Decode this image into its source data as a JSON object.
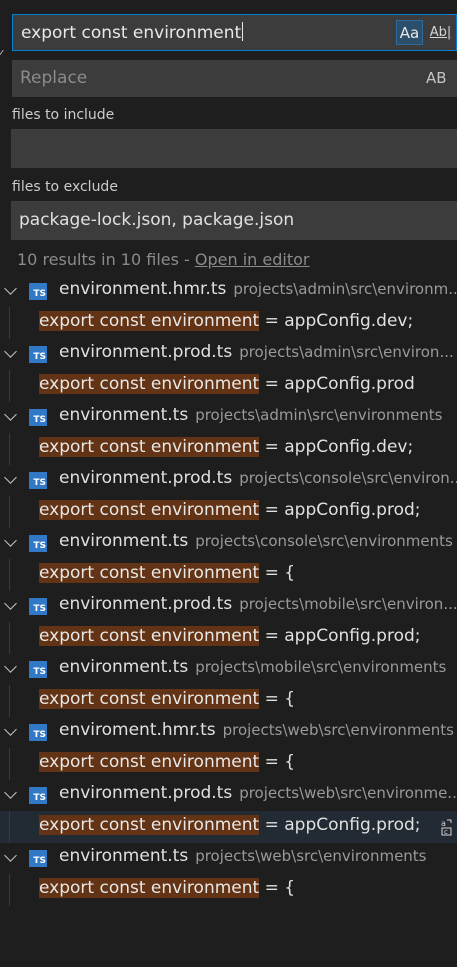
{
  "search": {
    "value": "export const environment",
    "match_case_label": "Aa",
    "whole_word_label": "Ab|"
  },
  "replace": {
    "placeholder": "Replace",
    "preserve_case_label": "AB"
  },
  "files_to_include": {
    "label": "files to include",
    "value": ""
  },
  "files_to_exclude": {
    "label": "files to exclude",
    "value": "package-lock.json, package.json"
  },
  "summary": {
    "text": "10 results in 10 files - ",
    "link": "Open in editor"
  },
  "results": [
    {
      "file": "environment.hmr.ts",
      "path": "projects\\admin\\src\\environm...",
      "match": "export const environment",
      "rest": " = appConfig.dev;"
    },
    {
      "file": "environment.prod.ts",
      "path": "projects\\admin\\src\\environ...",
      "match": "export const environment",
      "rest": " = appConfig.prod"
    },
    {
      "file": "environment.ts",
      "path": "projects\\admin\\src\\environments",
      "match": "export const environment",
      "rest": " = appConfig.dev;"
    },
    {
      "file": "environment.prod.ts",
      "path": "projects\\console\\src\\environ...",
      "match": "export const environment",
      "rest": " = appConfig.prod;"
    },
    {
      "file": "environment.ts",
      "path": "projects\\console\\src\\environments",
      "match": "export const environment",
      "rest": " = {"
    },
    {
      "file": "environment.prod.ts",
      "path": "projects\\mobile\\src\\environ...",
      "match": "export const environment",
      "rest": " = appConfig.prod;"
    },
    {
      "file": "environment.ts",
      "path": "projects\\mobile\\src\\environments",
      "match": "export const environment",
      "rest": " = {"
    },
    {
      "file": "enviroment.hmr.ts",
      "path": "projects\\web\\src\\environments",
      "match": "export const environment",
      "rest": " = {"
    },
    {
      "file": "environment.prod.ts",
      "path": "projects\\web\\src\\environme...",
      "match": "export const environment",
      "rest": " = appConfig.prod;"
    },
    {
      "file": "environment.ts",
      "path": "projects\\web\\src\\environments",
      "match": "export const environment",
      "rest": " = {"
    }
  ],
  "file_icon_label": "TS",
  "colors": {
    "background": "#1e1e1e",
    "input_background": "#3c3c3c",
    "focus_border": "#007fd4",
    "match_highlight": "#623315",
    "ts_icon": "#3178c6"
  }
}
